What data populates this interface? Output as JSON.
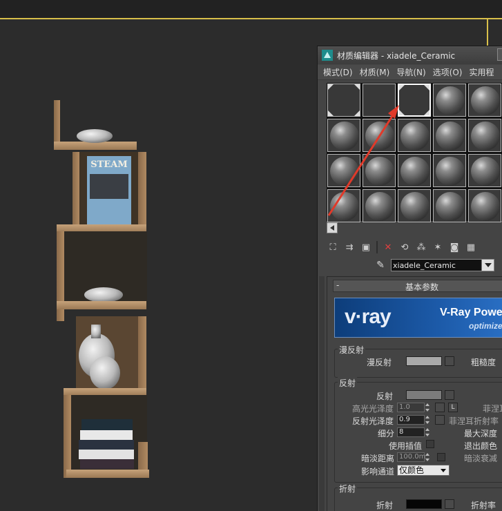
{
  "window": {
    "title": "材质编辑器 - xiadele_Ceramic"
  },
  "menu": [
    "模式(D)",
    "材质(M)",
    "导航(N)",
    "选项(O)",
    "实用程"
  ],
  "material_name": "xiadele_Ceramic",
  "rollout": {
    "minus": "-",
    "title": "基本参数"
  },
  "banner": {
    "logo": "v·ray",
    "text": "V-Ray Power",
    "sub": "optimized"
  },
  "diffuse": {
    "group": "漫反射",
    "label": "漫反射",
    "roughness_label": "粗糙度",
    "color": "#a9a9a9"
  },
  "reflection": {
    "group": "反射",
    "reflect_label": "反射",
    "reflect_color": "#7c7c7c",
    "hilight_label": "高光光泽度",
    "hilight_value": "1.0",
    "lock_label": "L",
    "fresnel_label": "菲涅耳",
    "gloss_label": "反射光泽度",
    "gloss_value": "0.9",
    "fresnel_ior_label": "菲涅耳折射率",
    "subdivs_label": "细分",
    "subdivs_value": "8",
    "max_depth_label": "最大深度",
    "interp_label": "使用插值",
    "exit_color_label": "退出颜色",
    "dim_dist_label": "暗淡距离",
    "dim_dist_value": "100.0m",
    "dim_falloff_label": "暗淡衰减",
    "affect_label": "影响通道",
    "affect_value": "仅颜色"
  },
  "refraction": {
    "group": "折射",
    "refract_label": "折射",
    "refract_color": "#050505",
    "ior_label": "折射率"
  },
  "colors": {
    "viewport_border": "#d9c04a",
    "arrow": "#e03a2a"
  }
}
